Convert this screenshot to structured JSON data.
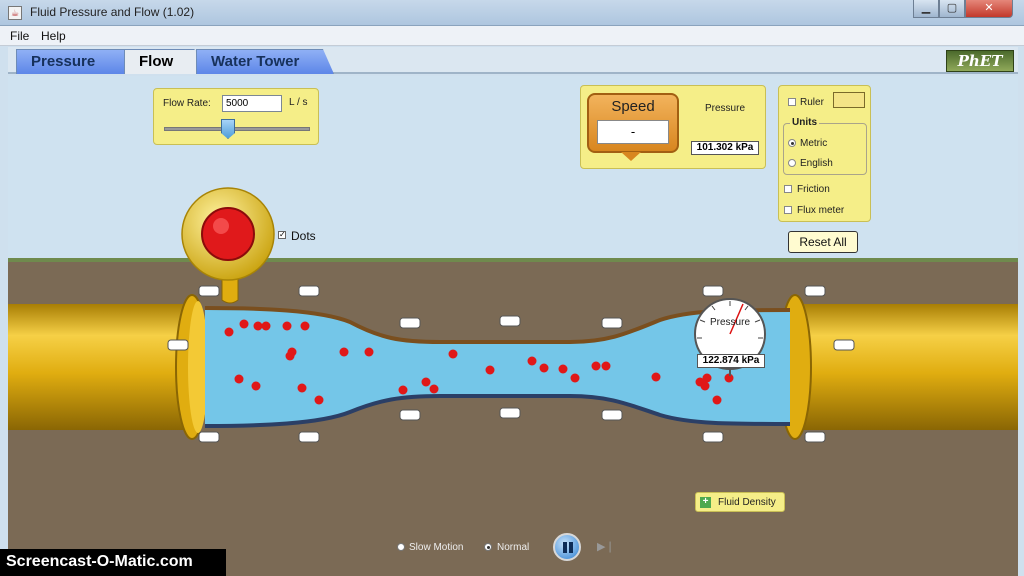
{
  "window": {
    "title": "Fluid Pressure and Flow (1.02)"
  },
  "menu": {
    "items": [
      "File",
      "Help"
    ]
  },
  "tabs": [
    {
      "label": "Pressure",
      "active": false
    },
    {
      "label": "Flow",
      "active": true
    },
    {
      "label": "Water Tower",
      "active": false
    }
  ],
  "logo": {
    "text": "PhET"
  },
  "flow_control": {
    "label": "Flow Rate:",
    "value": "5000",
    "unit": "L / s"
  },
  "speed_meter": {
    "title": "Speed",
    "value": "-"
  },
  "gauges": {
    "top": {
      "label": "Pressure",
      "value": "101.302 kPa"
    },
    "pipe": {
      "label": "Pressure",
      "value": "122.874 kPa"
    }
  },
  "options": {
    "ruler": {
      "label": "Ruler",
      "checked": false
    },
    "units": {
      "title": "Units",
      "metric": {
        "label": "Metric",
        "selected": true
      },
      "english": {
        "label": "English",
        "selected": false
      }
    },
    "friction": {
      "label": "Friction",
      "checked": false
    },
    "flux_meter": {
      "label": "Flux meter",
      "checked": false
    }
  },
  "reset_all": {
    "label": "Reset All"
  },
  "dots": {
    "label": "Dots",
    "checked": true
  },
  "fluid_density": {
    "label": "Fluid Density"
  },
  "playback": {
    "slow_motion": {
      "label": "Slow Motion",
      "selected": false
    },
    "normal": {
      "label": "Normal",
      "selected": true
    }
  },
  "watermark": {
    "text": "Screencast-O-Matic.com"
  },
  "colors": {
    "water": "#74c6e8",
    "pipe": "#e0ad10",
    "ground": "#7b6a55",
    "sky": "#cfe2f0",
    "panel": "#f5ee88",
    "dots": "#e01818"
  }
}
